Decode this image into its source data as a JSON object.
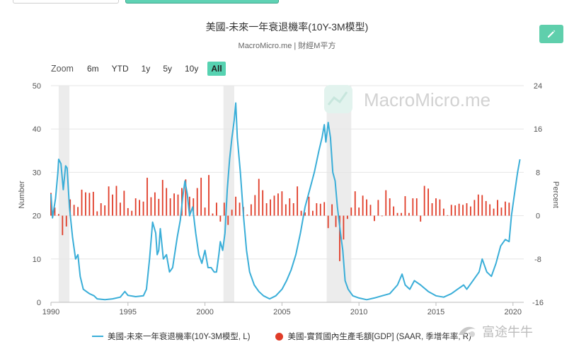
{
  "header": {
    "title": "美國-未來一年衰退機率(10Y-3M模型)",
    "subtitle": "MacroMicro.me | 財經M平方"
  },
  "toolbar": {
    "zoom_label": "Zoom",
    "buttons": [
      "6m",
      "YTD",
      "1y",
      "5y",
      "10y",
      "All"
    ],
    "active": "All"
  },
  "watermark": {
    "main": "MacroMicro.me",
    "corner": "富途牛牛"
  },
  "colors": {
    "line": "#3aaed8",
    "bar": "#e03c28",
    "recession": "#ececec",
    "accent": "#56d2b1"
  },
  "chart_data": {
    "type": "line+bar",
    "x_range": [
      1990.0,
      2020.7
    ],
    "x_ticks": [
      "1990",
      "1995",
      "2000",
      "2005",
      "2010",
      "2015",
      "2020"
    ],
    "y_left": {
      "label": "Number",
      "range": [
        0,
        50
      ],
      "ticks": [
        "0",
        "10",
        "20",
        "30",
        "40",
        "50"
      ]
    },
    "y_right": {
      "label": "Percent",
      "range": [
        -16,
        24
      ],
      "ticks": [
        "-16",
        "-8",
        "0",
        "8",
        "16",
        "24"
      ]
    },
    "recessions": [
      [
        1990.5,
        1991.2
      ],
      [
        2001.2,
        2001.9
      ],
      [
        2007.9,
        2009.5
      ]
    ],
    "legend": {
      "position": "bottom"
    },
    "series": [
      {
        "name": "美國-未來一年衰退機率(10Y-3M模型, L)",
        "axis": "left",
        "type": "line",
        "points": [
          [
            1990.0,
            25
          ],
          [
            1990.1,
            19.5
          ],
          [
            1990.3,
            24
          ],
          [
            1990.45,
            30
          ],
          [
            1990.5,
            33
          ],
          [
            1990.65,
            32
          ],
          [
            1990.8,
            26
          ],
          [
            1990.95,
            31.5
          ],
          [
            1991.05,
            31
          ],
          [
            1991.2,
            22
          ],
          [
            1991.4,
            15
          ],
          [
            1991.6,
            10
          ],
          [
            1991.75,
            11
          ],
          [
            1991.9,
            6
          ],
          [
            1992.1,
            3
          ],
          [
            1992.3,
            2.5
          ],
          [
            1992.5,
            2
          ],
          [
            1992.8,
            1.5
          ],
          [
            1993.0,
            0.8
          ],
          [
            1993.5,
            0.6
          ],
          [
            1994.0,
            0.8
          ],
          [
            1994.5,
            1.2
          ],
          [
            1994.8,
            2.5
          ],
          [
            1995.0,
            1.6
          ],
          [
            1995.5,
            1.3
          ],
          [
            1996.0,
            1.5
          ],
          [
            1996.2,
            3
          ],
          [
            1996.4,
            10
          ],
          [
            1996.6,
            18.5
          ],
          [
            1996.8,
            16
          ],
          [
            1996.9,
            11
          ],
          [
            1997.0,
            12
          ],
          [
            1997.1,
            17
          ],
          [
            1997.3,
            10
          ],
          [
            1997.5,
            11
          ],
          [
            1997.7,
            7
          ],
          [
            1997.9,
            8
          ],
          [
            1998.2,
            15
          ],
          [
            1998.4,
            19
          ],
          [
            1998.55,
            24
          ],
          [
            1998.7,
            28
          ],
          [
            1998.85,
            25
          ],
          [
            1999.0,
            20
          ],
          [
            1999.2,
            22
          ],
          [
            1999.4,
            16
          ],
          [
            1999.6,
            11
          ],
          [
            1999.8,
            9
          ],
          [
            2000.0,
            12
          ],
          [
            2000.2,
            8
          ],
          [
            2000.4,
            8
          ],
          [
            2000.6,
            7
          ],
          [
            2000.75,
            7
          ],
          [
            2000.9,
            11
          ],
          [
            2001.0,
            14
          ],
          [
            2001.15,
            12
          ],
          [
            2001.3,
            16
          ],
          [
            2001.45,
            26
          ],
          [
            2001.6,
            33
          ],
          [
            2001.75,
            38
          ],
          [
            2001.9,
            42
          ],
          [
            2002.0,
            46
          ],
          [
            2002.1,
            38
          ],
          [
            2002.3,
            30
          ],
          [
            2002.5,
            20
          ],
          [
            2002.7,
            12
          ],
          [
            2002.9,
            7
          ],
          [
            2003.2,
            4
          ],
          [
            2003.5,
            2.5
          ],
          [
            2003.8,
            1.5
          ],
          [
            2004.2,
            0.8
          ],
          [
            2004.6,
            1.5
          ],
          [
            2005.0,
            3
          ],
          [
            2005.3,
            5
          ],
          [
            2005.6,
            7.5
          ],
          [
            2005.9,
            11
          ],
          [
            2006.2,
            16
          ],
          [
            2006.5,
            22
          ],
          [
            2006.8,
            26
          ],
          [
            2007.1,
            30
          ],
          [
            2007.4,
            35
          ],
          [
            2007.6,
            38
          ],
          [
            2007.75,
            41
          ],
          [
            2007.85,
            37
          ],
          [
            2008.0,
            41.5
          ],
          [
            2008.15,
            38
          ],
          [
            2008.3,
            30
          ],
          [
            2008.45,
            28
          ],
          [
            2008.6,
            22
          ],
          [
            2008.8,
            16
          ],
          [
            2008.95,
            12
          ],
          [
            2009.1,
            5
          ],
          [
            2009.3,
            3
          ],
          [
            2009.6,
            1.5
          ],
          [
            2010.0,
            1
          ],
          [
            2010.5,
            0.6
          ],
          [
            2011.0,
            1
          ],
          [
            2011.5,
            1.5
          ],
          [
            2012.0,
            2
          ],
          [
            2012.5,
            4
          ],
          [
            2012.8,
            6.5
          ],
          [
            2013.0,
            4
          ],
          [
            2013.3,
            3
          ],
          [
            2013.6,
            5
          ],
          [
            2014.0,
            4
          ],
          [
            2014.5,
            2.5
          ],
          [
            2015.0,
            1.5
          ],
          [
            2015.5,
            1.2
          ],
          [
            2016.0,
            2
          ],
          [
            2016.4,
            3
          ],
          [
            2016.8,
            4
          ],
          [
            2017.0,
            3
          ],
          [
            2017.4,
            5
          ],
          [
            2017.8,
            7
          ],
          [
            2018.0,
            10
          ],
          [
            2018.3,
            7
          ],
          [
            2018.6,
            6
          ],
          [
            2018.9,
            9
          ],
          [
            2019.2,
            13
          ],
          [
            2019.5,
            14.5
          ],
          [
            2019.75,
            14
          ],
          [
            2019.9,
            20
          ],
          [
            2020.1,
            25
          ],
          [
            2020.3,
            30
          ],
          [
            2020.45,
            33
          ]
        ]
      },
      {
        "name": "美國-實質國內生產毛額[GDP] (SAAR, 季增年率, R)",
        "axis": "right",
        "type": "bar",
        "points": [
          [
            1990.0,
            4.2
          ],
          [
            1990.25,
            1.5
          ],
          [
            1990.5,
            0.3
          ],
          [
            1990.75,
            -3.6
          ],
          [
            1991.0,
            -2.0
          ],
          [
            1991.25,
            3.0
          ],
          [
            1991.5,
            2.0
          ],
          [
            1991.75,
            1.6
          ],
          [
            1992.0,
            4.8
          ],
          [
            1992.25,
            4.3
          ],
          [
            1992.5,
            4.2
          ],
          [
            1992.75,
            4.4
          ],
          [
            1993.0,
            0.8
          ],
          [
            1993.25,
            2.3
          ],
          [
            1993.5,
            1.9
          ],
          [
            1993.75,
            5.4
          ],
          [
            1994.0,
            3.9
          ],
          [
            1994.25,
            5.5
          ],
          [
            1994.5,
            2.4
          ],
          [
            1994.75,
            4.6
          ],
          [
            1995.0,
            1.4
          ],
          [
            1995.25,
            0.9
          ],
          [
            1995.5,
            3.2
          ],
          [
            1995.75,
            2.9
          ],
          [
            1996.0,
            2.6
          ],
          [
            1996.25,
            7.0
          ],
          [
            1996.5,
            3.4
          ],
          [
            1996.75,
            4.3
          ],
          [
            1997.0,
            3.1
          ],
          [
            1997.25,
            6.6
          ],
          [
            1997.5,
            5.1
          ],
          [
            1997.75,
            3.2
          ],
          [
            1998.0,
            4.1
          ],
          [
            1998.25,
            3.9
          ],
          [
            1998.5,
            5.1
          ],
          [
            1998.75,
            6.7
          ],
          [
            1999.0,
            3.5
          ],
          [
            1999.25,
            3.2
          ],
          [
            1999.5,
            5.1
          ],
          [
            1999.75,
            7.0
          ],
          [
            2000.0,
            1.5
          ],
          [
            2000.25,
            7.5
          ],
          [
            2000.5,
            0.4
          ],
          [
            2000.75,
            2.4
          ],
          [
            2001.0,
            -1.1
          ],
          [
            2001.25,
            2.4
          ],
          [
            2001.5,
            -1.7
          ],
          [
            2001.75,
            1.1
          ],
          [
            2002.0,
            3.5
          ],
          [
            2002.25,
            2.4
          ],
          [
            2002.5,
            1.6
          ],
          [
            2002.75,
            0.2
          ],
          [
            2003.0,
            2.1
          ],
          [
            2003.25,
            3.8
          ],
          [
            2003.5,
            6.8
          ],
          [
            2003.75,
            4.7
          ],
          [
            2004.0,
            2.3
          ],
          [
            2004.25,
            3.0
          ],
          [
            2004.5,
            3.7
          ],
          [
            2004.75,
            4.1
          ],
          [
            2005.0,
            4.5
          ],
          [
            2005.25,
            2.1
          ],
          [
            2005.5,
            3.2
          ],
          [
            2005.75,
            2.3
          ],
          [
            2006.0,
            5.4
          ],
          [
            2006.25,
            0.9
          ],
          [
            2006.5,
            0.6
          ],
          [
            2006.75,
            3.5
          ],
          [
            2007.0,
            0.9
          ],
          [
            2007.25,
            2.3
          ],
          [
            2007.5,
            2.2
          ],
          [
            2007.75,
            2.5
          ],
          [
            2008.0,
            -2.3
          ],
          [
            2008.25,
            2.1
          ],
          [
            2008.5,
            -2.1
          ],
          [
            2008.75,
            -8.4
          ],
          [
            2009.0,
            -4.4
          ],
          [
            2009.25,
            -0.6
          ],
          [
            2009.5,
            1.5
          ],
          [
            2009.75,
            4.5
          ],
          [
            2010.0,
            1.5
          ],
          [
            2010.25,
            3.7
          ],
          [
            2010.5,
            3.0
          ],
          [
            2010.75,
            2.0
          ],
          [
            2011.0,
            -1.0
          ],
          [
            2011.25,
            2.9
          ],
          [
            2011.5,
            -0.1
          ],
          [
            2011.75,
            4.7
          ],
          [
            2012.0,
            3.2
          ],
          [
            2012.25,
            1.7
          ],
          [
            2012.5,
            0.5
          ],
          [
            2012.75,
            0.5
          ],
          [
            2013.0,
            3.6
          ],
          [
            2013.25,
            0.5
          ],
          [
            2013.5,
            3.2
          ],
          [
            2013.75,
            3.2
          ],
          [
            2014.0,
            -1.1
          ],
          [
            2014.25,
            5.5
          ],
          [
            2014.5,
            5.0
          ],
          [
            2014.75,
            2.3
          ],
          [
            2015.0,
            3.2
          ],
          [
            2015.25,
            3.0
          ],
          [
            2015.5,
            1.3
          ],
          [
            2015.75,
            0.1
          ],
          [
            2016.0,
            2.0
          ],
          [
            2016.25,
            1.9
          ],
          [
            2016.5,
            2.2
          ],
          [
            2016.75,
            2.0
          ],
          [
            2017.0,
            2.3
          ],
          [
            2017.25,
            1.7
          ],
          [
            2017.5,
            2.9
          ],
          [
            2017.75,
            3.9
          ],
          [
            2018.0,
            3.8
          ],
          [
            2018.25,
            2.7
          ],
          [
            2018.5,
            2.1
          ],
          [
            2018.75,
            1.3
          ],
          [
            2019.0,
            2.9
          ],
          [
            2019.25,
            1.5
          ],
          [
            2019.5,
            2.6
          ],
          [
            2019.75,
            2.4
          ]
        ]
      }
    ]
  }
}
